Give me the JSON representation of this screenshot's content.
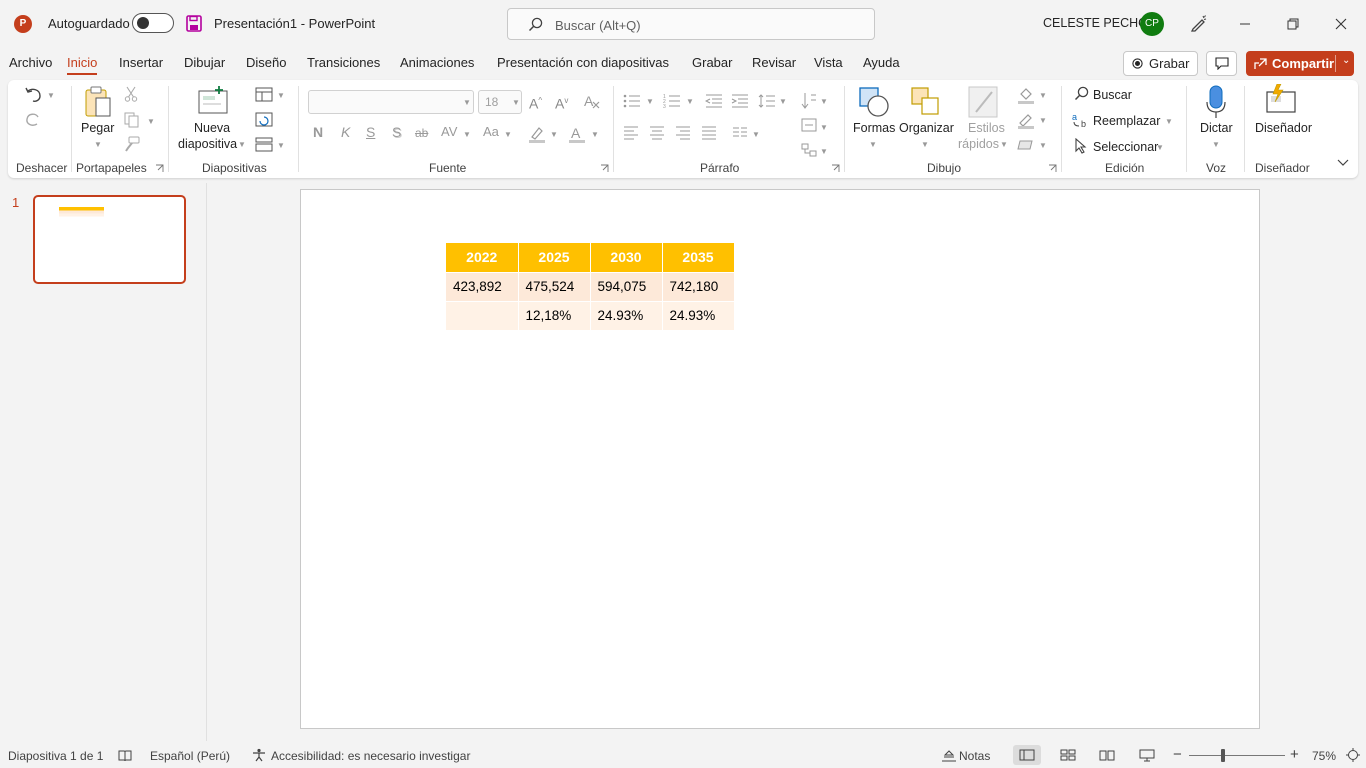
{
  "titlebar": {
    "app_initial": "P",
    "autosave_label": "Autoguardado",
    "autosave_on": false,
    "document_title": "Presentación1  -  PowerPoint",
    "search_placeholder": "Buscar (Alt+Q)",
    "user_name": "CELESTE PECHO",
    "user_initials": "CP"
  },
  "menu": {
    "items": [
      "Archivo",
      "Inicio",
      "Insertar",
      "Dibujar",
      "Diseño",
      "Transiciones",
      "Animaciones",
      "Presentación con diapositivas",
      "Grabar",
      "Revisar",
      "Vista",
      "Ayuda"
    ],
    "active": "Inicio",
    "record_label": "Grabar",
    "share_label": "Compartir"
  },
  "ribbon": {
    "groups": {
      "undo": "Deshacer",
      "clipboard": "Portapapeles",
      "slides": "Diapositivas",
      "font": "Fuente",
      "paragraph": "Párrafo",
      "drawing": "Dibujo",
      "editing": "Edición",
      "voice": "Voz",
      "designer": "Diseñador"
    },
    "paste_label": "Pegar",
    "new_slide_line1": "Nueva",
    "new_slide_line2": "diapositiva",
    "font_size": "18",
    "font_buttons": {
      "bold": "N",
      "italic": "K",
      "underline": "S",
      "shadow": "S",
      "strike": "ab",
      "spacing": "AV",
      "case": "Aa"
    },
    "shapes_label": "Formas",
    "arrange_label": "Organizar",
    "quick_styles_line1": "Estilos",
    "quick_styles_line2": "rápidos",
    "find_label": "Buscar",
    "replace_label": "Reemplazar",
    "select_label": "Seleccionar",
    "dictate_label": "Dictar",
    "designer_label": "Diseñador"
  },
  "slides_pane": {
    "slide_number": "1"
  },
  "slide": {
    "table": {
      "headers": [
        "2022",
        "2025",
        "2030",
        "2035"
      ],
      "rows": [
        [
          "423,892",
          "475,524",
          "594,075",
          "742,180"
        ],
        [
          "",
          "12,18%",
          "24.93%",
          "24.93%"
        ]
      ]
    }
  },
  "status": {
    "slide_counter": "Diapositiva 1 de 1",
    "language": "Español (Perú)",
    "accessibility": "Accesibilidad: es necesario investigar",
    "notes_label": "Notas",
    "zoom": "75%"
  },
  "colors": {
    "accent": "#c43e1c",
    "table_header": "#ffc000",
    "table_row1": "#fde9d9",
    "table_row2": "#fff2e6",
    "avatar": "#107c10"
  }
}
